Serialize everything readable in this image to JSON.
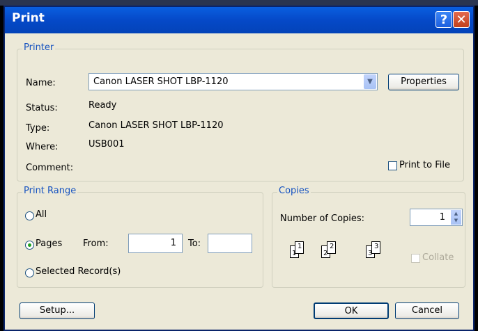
{
  "window": {
    "title": "Print",
    "help_glyph": "?",
    "close_glyph": "✕"
  },
  "printer": {
    "legend": "Printer",
    "name_label": "Name:",
    "name_value": "Canon LASER SHOT LBP-1120",
    "properties_button": "Properties",
    "status_label": "Status:",
    "status_value": "Ready",
    "type_label": "Type:",
    "type_value": "Canon LASER SHOT LBP-1120",
    "where_label": "Where:",
    "where_value": "USB001",
    "comment_label": "Comment:",
    "print_to_file_label": "Print to File",
    "print_to_file_checked": false
  },
  "print_range": {
    "legend": "Print Range",
    "all_label": "All",
    "pages_label": "Pages",
    "from_label": "From:",
    "from_value": "1",
    "to_label": "To:",
    "to_value": "",
    "selected_label": "Selected Record(s)",
    "selected_option": "pages"
  },
  "copies": {
    "legend": "Copies",
    "number_label": "Number of Copies:",
    "number_value": "1",
    "collate_label": "Collate",
    "collate_enabled": false,
    "stack_labels": [
      "1",
      "1",
      "2",
      "2",
      "3",
      "3"
    ]
  },
  "buttons": {
    "setup": "Setup...",
    "ok": "OK",
    "cancel": "Cancel"
  },
  "icons": [
    "help-icon",
    "close-icon",
    "dropdown-arrow-icon",
    "spin-up-icon",
    "spin-down-icon",
    "collate-pages-icon"
  ]
}
